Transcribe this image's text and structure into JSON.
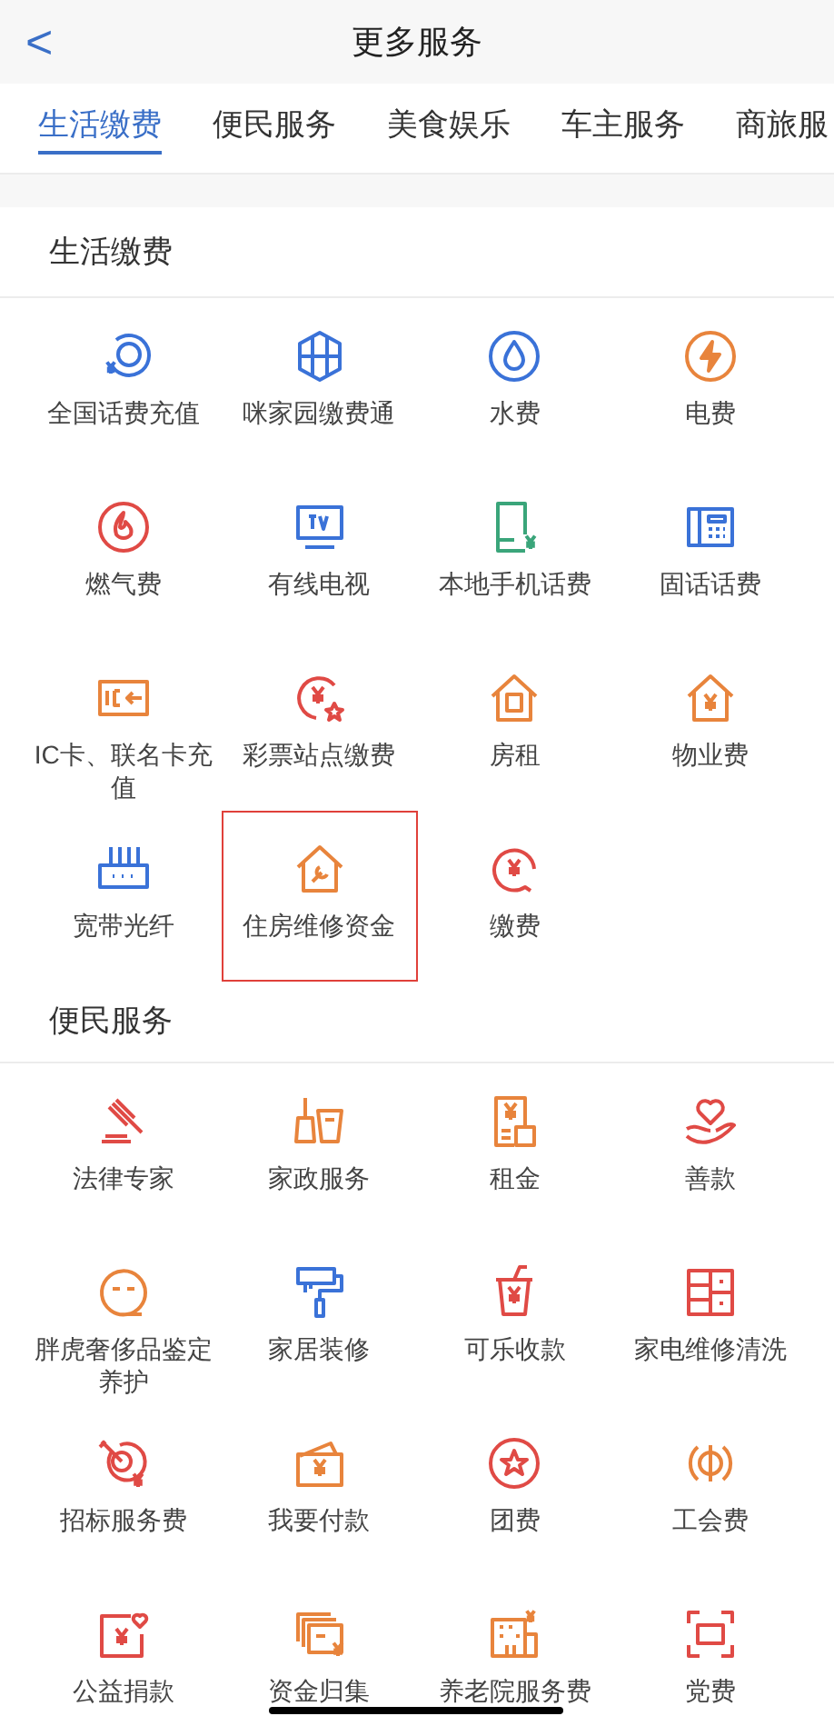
{
  "header": {
    "back": "<",
    "title": "更多服务"
  },
  "tabs": [
    {
      "label": "生活缴费",
      "selected": true
    },
    {
      "label": "便民服务",
      "selected": false
    },
    {
      "label": "美食娱乐",
      "selected": false
    },
    {
      "label": "车主服务",
      "selected": false
    },
    {
      "label": "商旅服",
      "selected": false
    }
  ],
  "sections": [
    {
      "title": "生活缴费",
      "items": [
        {
          "label": "全国话费充值",
          "selected": false
        },
        {
          "label": "咪家园缴费通",
          "selected": false
        },
        {
          "label": "水费",
          "selected": false
        },
        {
          "label": "电费",
          "selected": false
        },
        {
          "label": "燃气费",
          "selected": false
        },
        {
          "label": "有线电视",
          "selected": false
        },
        {
          "label": "本地手机话费",
          "selected": false
        },
        {
          "label": "固话话费",
          "selected": false
        },
        {
          "label": "IC卡、联名卡充值",
          "selected": false
        },
        {
          "label": "彩票站点缴费",
          "selected": false
        },
        {
          "label": "房租",
          "selected": false
        },
        {
          "label": "物业费",
          "selected": false
        },
        {
          "label": "宽带光纤",
          "selected": false
        },
        {
          "label": "住房维修资金",
          "selected": true
        },
        {
          "label": "缴费",
          "selected": false
        }
      ]
    },
    {
      "title": "便民服务",
      "items": [
        {
          "label": "法律专家",
          "selected": false
        },
        {
          "label": "家政服务",
          "selected": false
        },
        {
          "label": "租金",
          "selected": false
        },
        {
          "label": "善款",
          "selected": false
        },
        {
          "label": "胖虎奢侈品鉴定养护",
          "selected": false
        },
        {
          "label": "家居装修",
          "selected": false
        },
        {
          "label": "可乐收款",
          "selected": false
        },
        {
          "label": "家电维修清洗",
          "selected": false
        },
        {
          "label": "招标服务费",
          "selected": false
        },
        {
          "label": "我要付款",
          "selected": false
        },
        {
          "label": "团费",
          "selected": false
        },
        {
          "label": "工会费",
          "selected": false
        },
        {
          "label": "公益捐款",
          "selected": false
        },
        {
          "label": "资金归集",
          "selected": false
        },
        {
          "label": "养老院服务费",
          "selected": false
        },
        {
          "label": "党费",
          "selected": false
        }
      ]
    }
  ]
}
